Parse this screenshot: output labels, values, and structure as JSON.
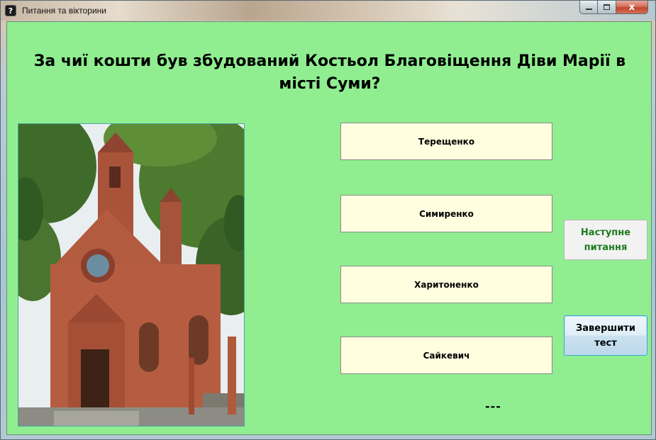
{
  "window": {
    "title": "Питання та вікторини",
    "app_icon_glyph": "?",
    "controls": {
      "close_glyph": "x"
    }
  },
  "question": {
    "text": "За чиї кошти був збудований Костьол Благовіщення Діви Марії в місті Суми?"
  },
  "image": {
    "icon": "church-photo",
    "subject": "red brick church"
  },
  "answers": [
    {
      "label": "Терещенко"
    },
    {
      "label": "Симиренко"
    },
    {
      "label": "Харитоненко"
    },
    {
      "label": "Сайкевич"
    }
  ],
  "buttons": {
    "next_label": "Наступне питання",
    "finish_label": "Завершити тест"
  },
  "status_text": "---",
  "colors": {
    "background": "#90ee90",
    "answer_bg": "#ffffe0",
    "next_text": "#1e7b1e",
    "finish_border": "#3c9fd6"
  }
}
